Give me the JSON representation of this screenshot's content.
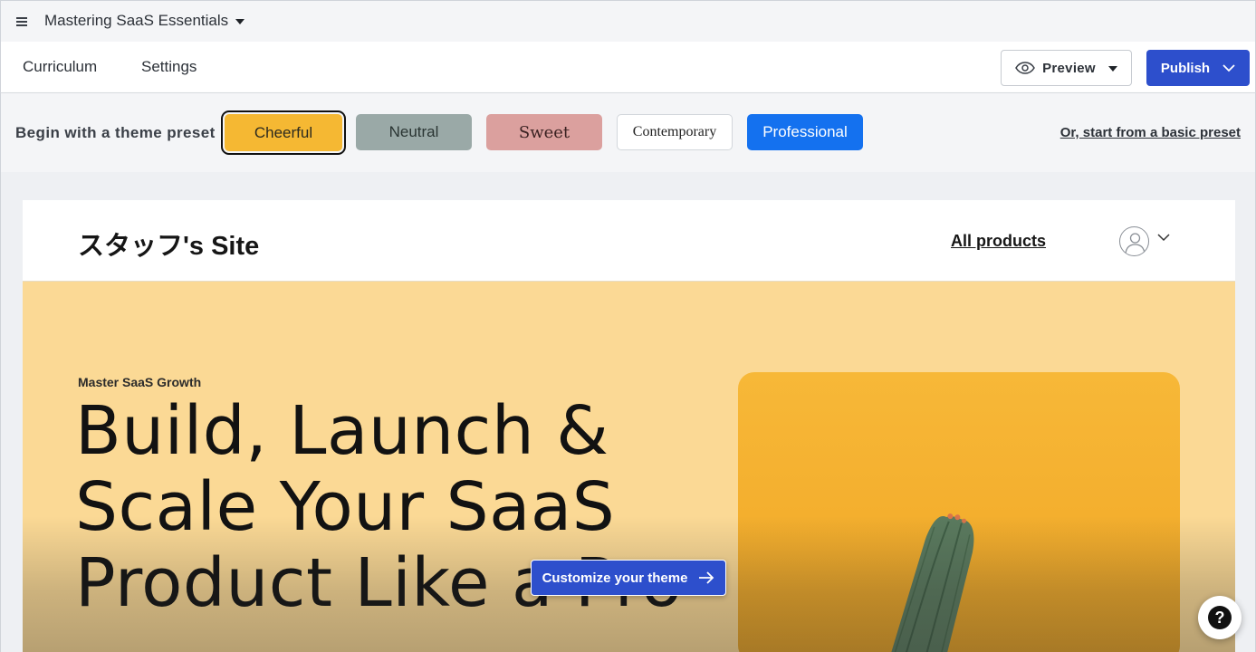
{
  "app": {
    "course_title": "Mastering SaaS Essentials"
  },
  "nav": {
    "tabs": [
      {
        "label": "Curriculum"
      },
      {
        "label": "Settings"
      }
    ],
    "preview_label": "Preview",
    "publish_label": "Publish"
  },
  "presets": {
    "label": "Begin with a theme preset",
    "items": [
      {
        "label": "Cheerful",
        "color": "#f5b833",
        "selected": true
      },
      {
        "label": "Neutral",
        "color": "#9aa9a7"
      },
      {
        "label": "Sweet",
        "color": "#dba09e"
      },
      {
        "label": "Contemporary",
        "color": "#ffffff"
      },
      {
        "label": "Professional",
        "color": "#1471ef"
      }
    ],
    "basic_link": "Or, start from a basic preset"
  },
  "site": {
    "name": "スタッフ's Site",
    "all_products": "All products",
    "eyebrow": "Master SaaS Growth",
    "headline": "Build, Launch & Scale Your SaaS Product Like a Pro",
    "accent_color": "#fbd995"
  },
  "actions": {
    "customize_label": "Customize your theme",
    "help_label": "?"
  },
  "icons": {
    "menu": "hamburger-icon",
    "preview": "eye-icon",
    "publish_dropdown": "chevron-down-icon",
    "avatar": "user-avatar-icon",
    "customize": "arrow-right-icon",
    "help": "question-mark-icon"
  },
  "colors": {
    "primary": "#2d4fcc",
    "hero_background": "#fbd995",
    "hero_image": "#f5b833"
  }
}
